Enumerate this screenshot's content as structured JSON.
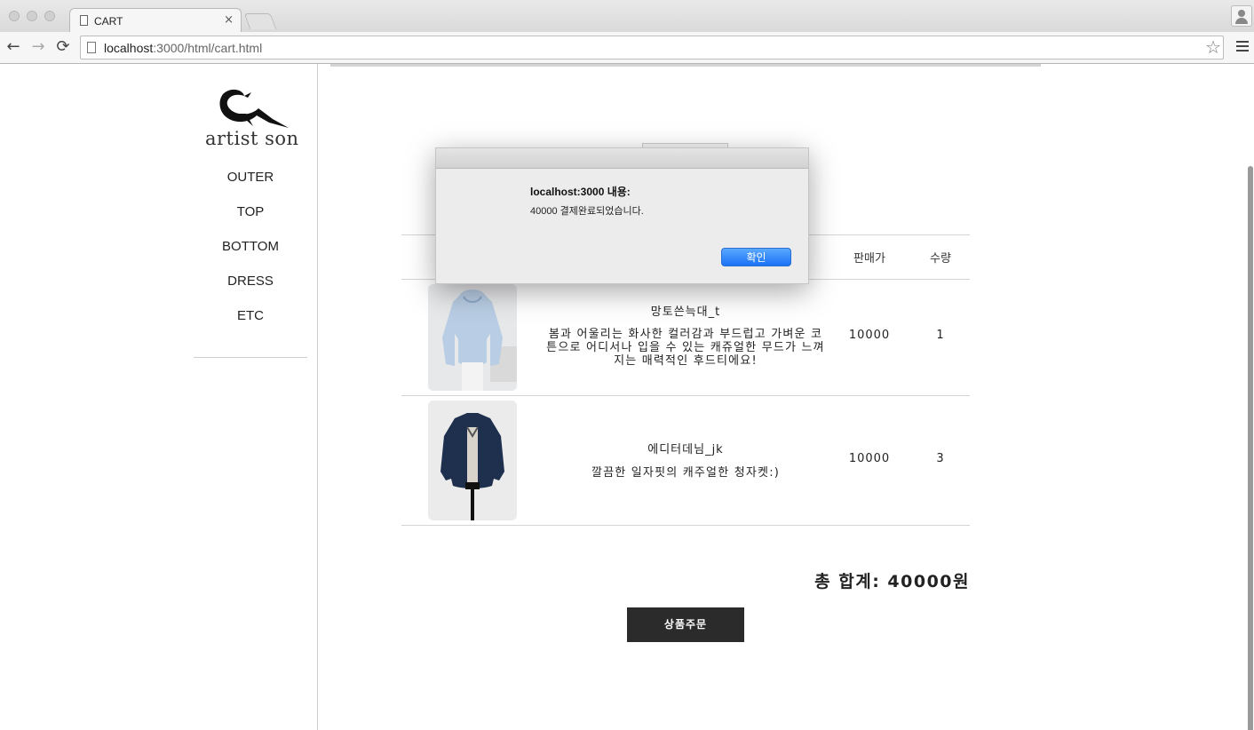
{
  "browser": {
    "tab_title": "CART",
    "tab_close": "×",
    "url_host": "localhost",
    "url_path": ":3000/html/cart.html",
    "back_glyph": "←",
    "forward_glyph": "→",
    "reload_glyph": "⟳",
    "star_glyph": "☆"
  },
  "brand": {
    "name": "artist son"
  },
  "nav": [
    "OUTER",
    "TOP",
    "BOTTOM",
    "DRESS",
    "ETC"
  ],
  "table": {
    "headers": {
      "price": "판매가",
      "quantity": "수량"
    },
    "rows": [
      {
        "name": "망토쓴늑대_t",
        "description": "봄과 어울리는 화사한 컬러감과 부드럽고 가벼운 코튼으로 어디서나 입을 수 있는 캐쥬얼한 무드가 느껴지는 매력적인 후드티에요!",
        "price": "10000",
        "quantity": "1",
        "image": "light-blue-hoodie-photo"
      },
      {
        "name": "에디터데님_jk",
        "description": "깔끔한 일자핏의 캐주얼한 청자켓:)",
        "price": "10000",
        "quantity": "3",
        "image": "denim-jacket-photo"
      }
    ]
  },
  "total_label": "총 합계: 40000원",
  "order_button": "상품주문",
  "dialog": {
    "heading": "localhost:3000 내용:",
    "message": "40000 결제완료되었습니다.",
    "ok_label": "확인"
  }
}
